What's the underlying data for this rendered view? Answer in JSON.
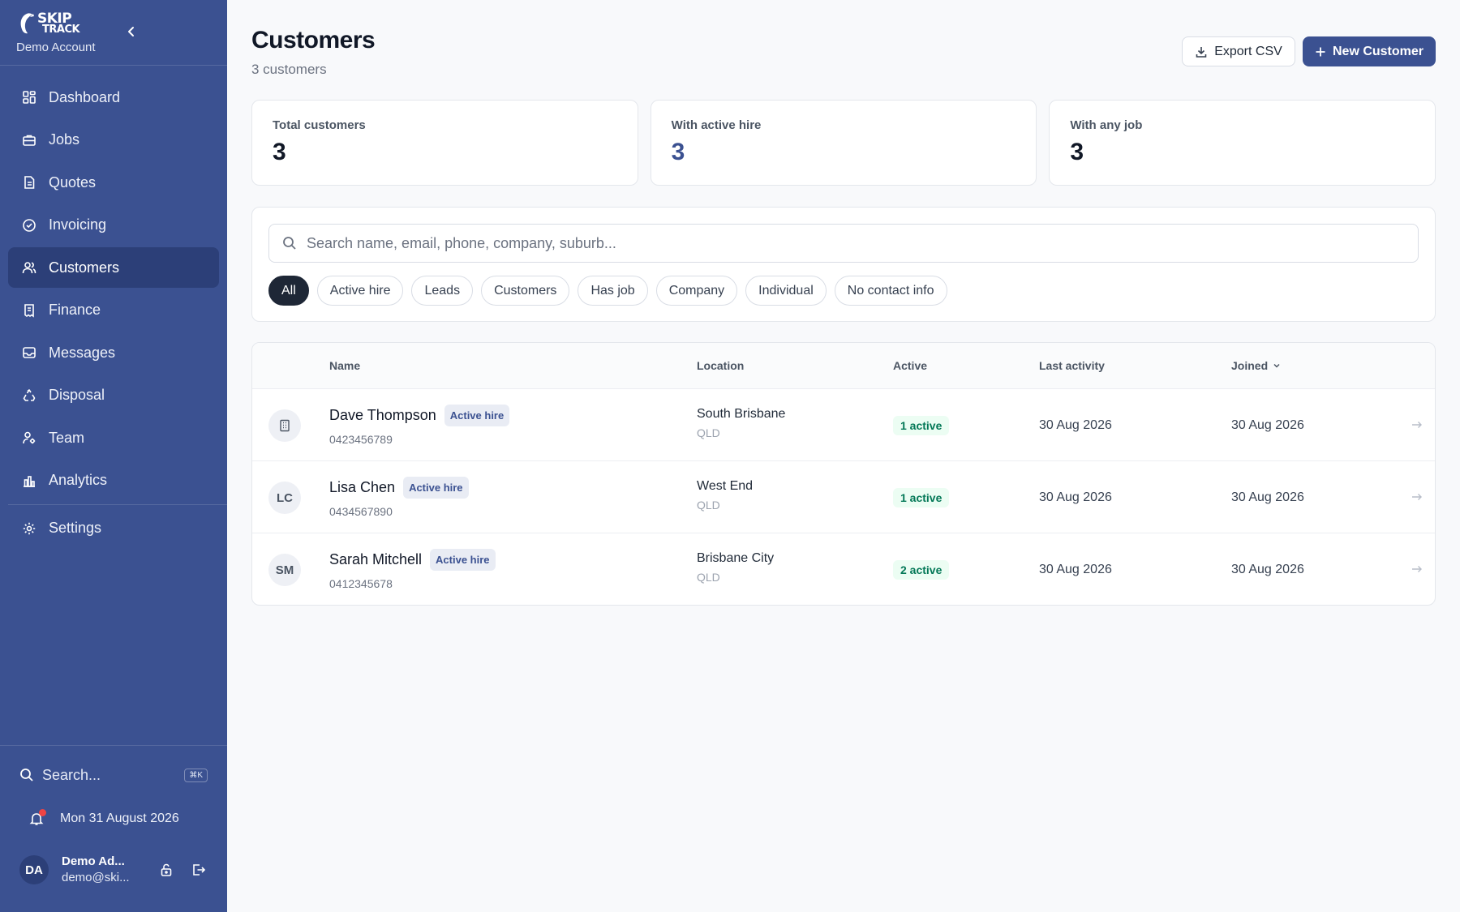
{
  "brand": {
    "logo_line1": "SKIP",
    "logo_line2": "TRACK",
    "account": "Demo Account"
  },
  "nav": [
    {
      "label": "Dashboard",
      "icon": "grid-icon",
      "active": false
    },
    {
      "label": "Jobs",
      "icon": "briefcase-icon",
      "active": false
    },
    {
      "label": "Quotes",
      "icon": "document-icon",
      "active": false
    },
    {
      "label": "Invoicing",
      "icon": "check-circle-icon",
      "active": false
    },
    {
      "label": "Customers",
      "icon": "users-icon",
      "active": true
    },
    {
      "label": "Finance",
      "icon": "receipt-icon",
      "active": false
    },
    {
      "label": "Messages",
      "icon": "inbox-icon",
      "active": false
    },
    {
      "label": "Disposal",
      "icon": "recycle-icon",
      "active": false
    },
    {
      "label": "Team",
      "icon": "user-cog-icon",
      "active": false
    },
    {
      "label": "Analytics",
      "icon": "bar-chart-icon",
      "active": false
    },
    {
      "label": "Settings",
      "icon": "gear-icon",
      "active": false
    }
  ],
  "sidebar_bottom": {
    "search_label": "Search...",
    "shortcut": "⌘K",
    "date": "Mon 31 August 2026",
    "user_initials": "DA",
    "user_name": "Demo Ad...",
    "user_email": "demo@ski..."
  },
  "header": {
    "title": "Customers",
    "subtitle": "3 customers",
    "export_label": "Export CSV",
    "new_label": "New Customer"
  },
  "stats": [
    {
      "label": "Total customers",
      "value": "3"
    },
    {
      "label": "With active hire",
      "value": "3"
    },
    {
      "label": "With any job",
      "value": "3"
    }
  ],
  "search": {
    "placeholder": "Search name, email, phone, company, suburb..."
  },
  "filters": [
    "All",
    "Active hire",
    "Leads",
    "Customers",
    "Has job",
    "Company",
    "Individual",
    "No contact info"
  ],
  "table": {
    "columns": {
      "name": "Name",
      "location": "Location",
      "active": "Active",
      "last_activity": "Last activity",
      "joined": "Joined"
    },
    "rows": [
      {
        "avatar": "",
        "avatar_icon": "building-icon",
        "name": "Dave Thompson",
        "badge": "Active hire",
        "phone": "0423456789",
        "suburb": "South Brisbane",
        "state": "QLD",
        "active": "1 active",
        "last_activity": "30 Aug 2026",
        "joined": "30 Aug 2026"
      },
      {
        "avatar": "LC",
        "avatar_icon": "",
        "name": "Lisa Chen",
        "badge": "Active hire",
        "phone": "0434567890",
        "suburb": "West End",
        "state": "QLD",
        "active": "1 active",
        "last_activity": "30 Aug 2026",
        "joined": "30 Aug 2026"
      },
      {
        "avatar": "SM",
        "avatar_icon": "",
        "name": "Sarah Mitchell",
        "badge": "Active hire",
        "phone": "0412345678",
        "suburb": "Brisbane City",
        "state": "QLD",
        "active": "2 active",
        "last_activity": "30 Aug 2026",
        "joined": "30 Aug 2026"
      }
    ]
  },
  "colors": {
    "sidebar": "#3b5191",
    "sidebar_active": "#2c3f78",
    "primary": "#3b5191",
    "active_badge_text": "#047857",
    "notification_dot": "#ef4444"
  }
}
